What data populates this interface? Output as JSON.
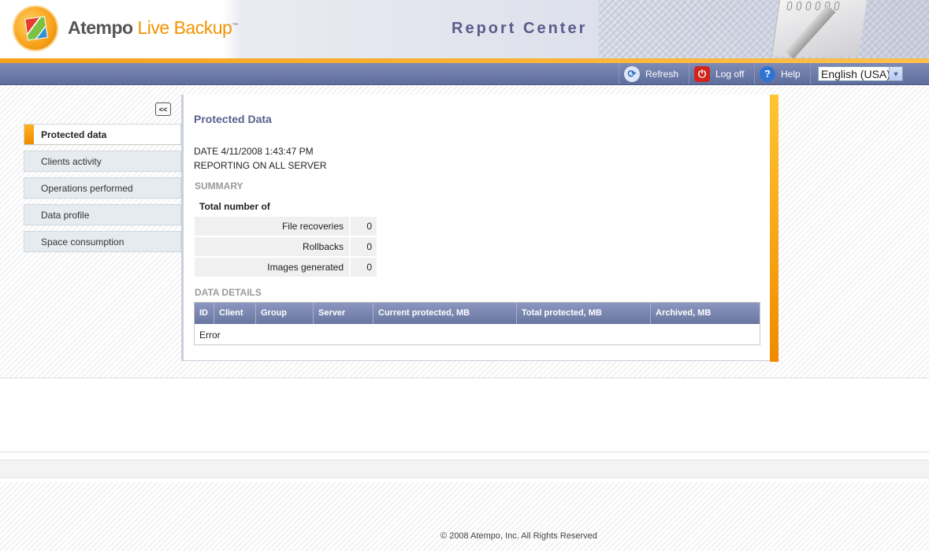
{
  "header": {
    "brand_primary": "Atempo ",
    "brand_secondary": "Live Backup",
    "brand_tm": "™",
    "title": "Report Center"
  },
  "toolbar": {
    "refresh_label": "Refresh",
    "logoff_label": "Log off",
    "help_label": "Help",
    "language_value": "English (USA)"
  },
  "sidebar": {
    "collapse_label": "<<",
    "items": [
      {
        "label": "Protected data",
        "active": true
      },
      {
        "label": "Clients activity"
      },
      {
        "label": "Operations performed"
      },
      {
        "label": "Data profile"
      },
      {
        "label": "Space consumption"
      }
    ]
  },
  "report": {
    "title": "Protected Data",
    "date_line": "DATE 4/11/2008 1:43:47 PM",
    "scope_line": "REPORTING ON ALL SERVER",
    "summary_heading": "SUMMARY",
    "totals_heading": "Total number of",
    "totals": [
      {
        "label": "File recoveries",
        "value": "0"
      },
      {
        "label": "Rollbacks",
        "value": "0"
      },
      {
        "label": "Images generated",
        "value": "0"
      }
    ],
    "details_heading": "DATA DETAILS",
    "columns": [
      "ID",
      "Client",
      "Group",
      "Server",
      "Current protected, MB",
      "Total protected, MB",
      "Archived, MB"
    ],
    "grid_message": "Error"
  },
  "footer": {
    "copyright": "© 2008 Atempo, Inc. All Rights Reserved"
  },
  "colors": {
    "accent_orange": "#f7a21b",
    "toolbar_blue": "#6e7ba9",
    "title_purple": "#5b5f8d"
  },
  "icons": [
    "refresh-icon",
    "power-icon",
    "help-icon",
    "chevron-down-icon",
    "collapse-icon"
  ]
}
